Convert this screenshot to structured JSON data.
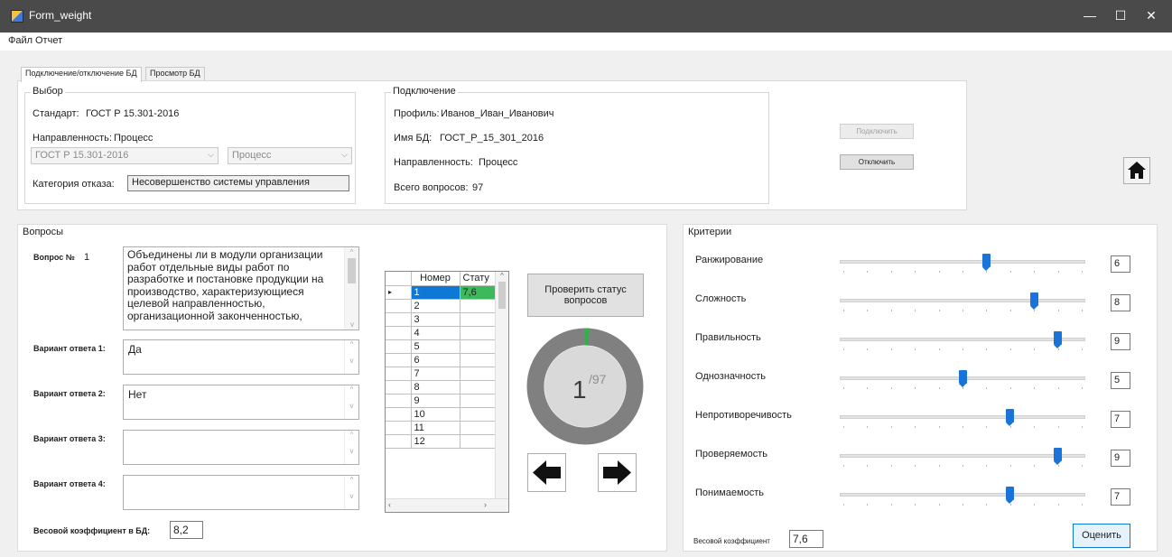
{
  "window": {
    "title": "Form_weight",
    "controls": {
      "minimize": "—",
      "maximize": "☐",
      "close": "✕"
    }
  },
  "menu": {
    "file": "Файл",
    "report": "Отчет"
  },
  "tabs": [
    {
      "label": "Подключение/отключение БД"
    },
    {
      "label": "Просмотр БД"
    }
  ],
  "selection": {
    "title": "Выбор",
    "standard_label": "Стандарт:",
    "standard_value": "ГОСТ Р 15.301-2016",
    "direction_label": "Направленность:",
    "direction_value": "Процесс",
    "combo_standard": "ГОСТ Р 15.301-2016",
    "combo_direction": "Процесс",
    "category_label": "Категория отказа:",
    "category_value": "Несовершенство системы управления"
  },
  "connection": {
    "title": "Подключение",
    "profile_label": "Профиль:",
    "profile_value": "Иванов_Иван_Иванович",
    "db_label": "Имя БД:",
    "db_value": "ГОСТ_Р_15_301_2016",
    "direction_label": "Направленность:",
    "direction_value": "Процесс",
    "total_label": "Всего вопросов:",
    "total_value": "97",
    "connect_button": "Подключить",
    "disconnect_button": "Отключить"
  },
  "questions": {
    "title": "Вопросы",
    "question_label": "Вопрос №",
    "question_number": "1",
    "question_text": "Объединены ли в модули организации работ отдельные виды работ по разработке и постановке продукции на производство, характеризующиеся целевой направленностью, организационной законченностью,",
    "answers": [
      {
        "label": "Вариант ответа 1:",
        "value": "Да"
      },
      {
        "label": "Вариант ответа 2:",
        "value": "Нет"
      },
      {
        "label": "Вариант ответа 3:",
        "value": ""
      },
      {
        "label": "Вариант ответа 4:",
        "value": ""
      }
    ],
    "weight_label": "Весовой коэффициент в БД:",
    "weight_value": "8,2",
    "grid": {
      "headers": [
        "Номер",
        "Стату"
      ],
      "rows": [
        [
          "1",
          "7,6"
        ],
        [
          "2",
          ""
        ],
        [
          "3",
          ""
        ],
        [
          "4",
          ""
        ],
        [
          "5",
          ""
        ],
        [
          "6",
          ""
        ],
        [
          "7",
          ""
        ],
        [
          "8",
          ""
        ],
        [
          "9",
          ""
        ],
        [
          "10",
          ""
        ],
        [
          "11",
          ""
        ],
        [
          "12",
          ""
        ]
      ]
    },
    "check_button": "Проверить статус вопросов",
    "progress": {
      "current": "1",
      "total": "/97",
      "fraction": 0.0103
    },
    "colors": {
      "ring": "#808080",
      "ring_fill": "#2fb24a",
      "grid_selected": "#0f78d7",
      "grid_status": "#3cb95a"
    }
  },
  "criteria": {
    "title": "Критерии",
    "items": [
      {
        "label": "Ранжирование",
        "value": "6"
      },
      {
        "label": "Сложность",
        "value": "8"
      },
      {
        "label": "Правильность",
        "value": "9"
      },
      {
        "label": "Однозначность",
        "value": "5"
      },
      {
        "label": "Непротиворечивость",
        "value": "7"
      },
      {
        "label": "Проверяемость",
        "value": "9"
      },
      {
        "label": "Понимаемость",
        "value": "7"
      }
    ],
    "slider_max": 10,
    "weight_label": "Весовой коэффициент",
    "weight_value": "7,6",
    "evaluate_button": "Оценить"
  },
  "icons": [
    "home-icon",
    "arrow-left-icon",
    "arrow-right-icon",
    "dropdown-icon",
    "scroll-up-icon",
    "scroll-down-icon"
  ]
}
